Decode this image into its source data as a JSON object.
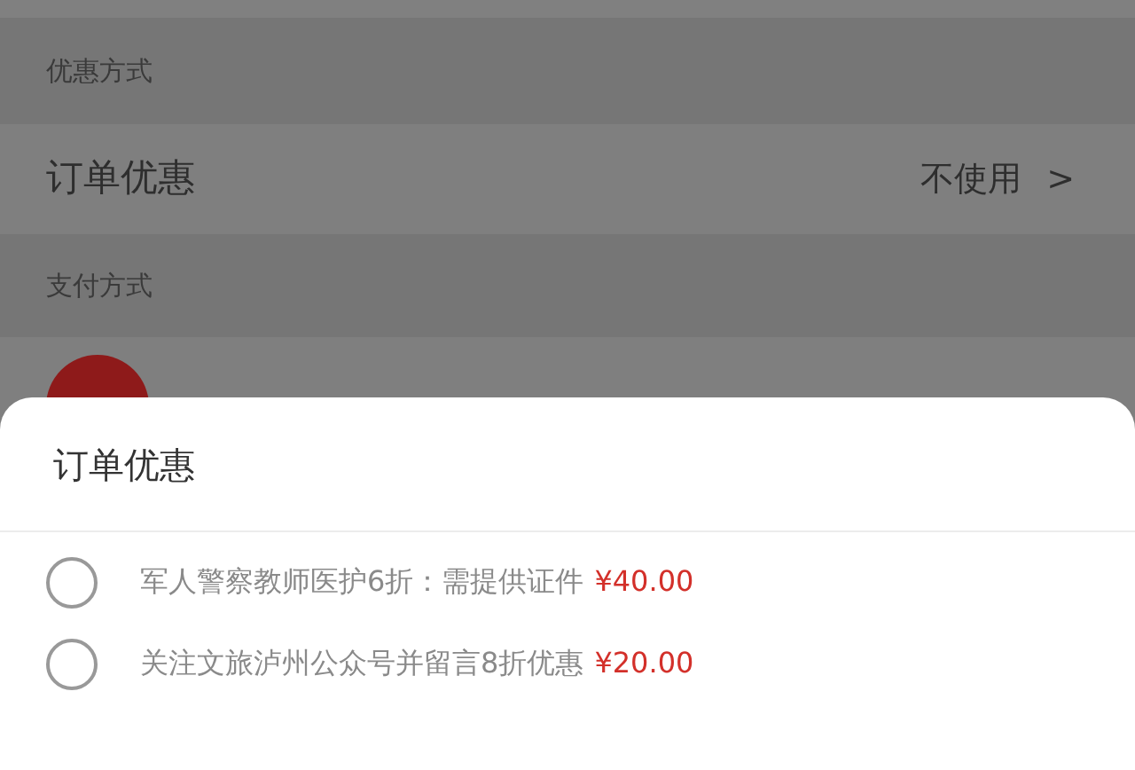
{
  "page": {
    "discount_section": "优惠方式",
    "order_discount": {
      "label": "订单优惠",
      "value": "不使用",
      "chevron": ">"
    },
    "payment_section": "支付方式"
  },
  "sheet": {
    "title": "订单优惠",
    "options": [
      {
        "label": "军人警察教师医护6折：需提供证件",
        "amount": "¥40.00",
        "selected": false
      },
      {
        "label": "关注文旅泸州公众号并留言8折优惠",
        "amount": "¥20.00",
        "selected": false
      }
    ]
  }
}
